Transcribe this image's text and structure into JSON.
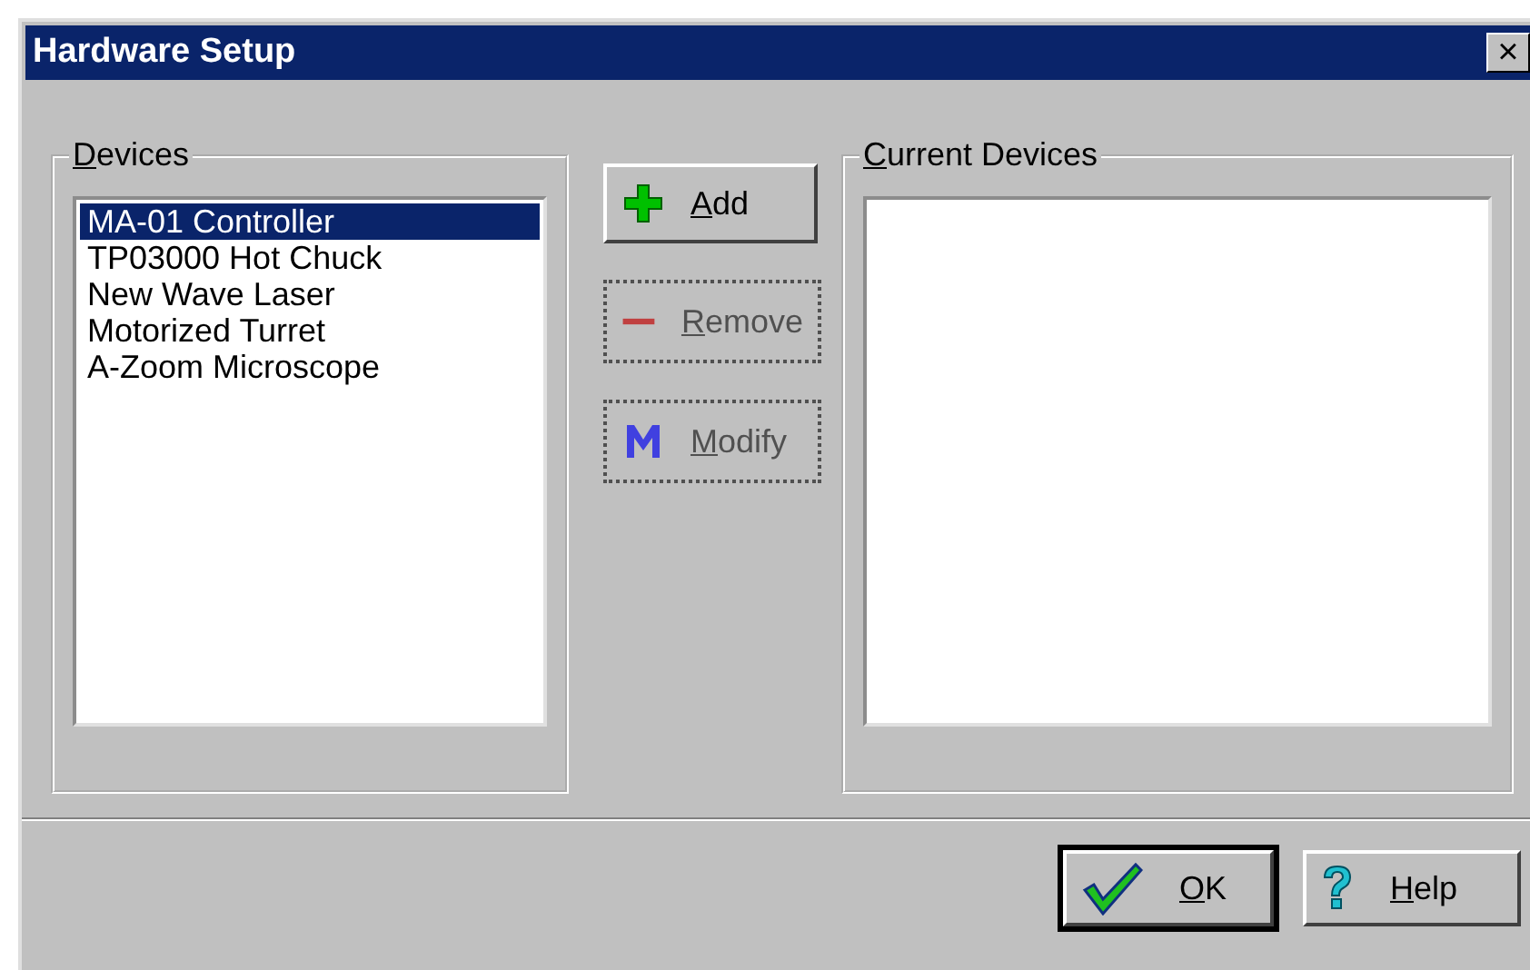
{
  "window": {
    "title": "Hardware Setup",
    "close": "×"
  },
  "devices": {
    "label": "Devices",
    "items": [
      {
        "label": "MA-01 Controller",
        "selected": true
      },
      {
        "label": "TP03000 Hot Chuck",
        "selected": false
      },
      {
        "label": "New Wave Laser",
        "selected": false
      },
      {
        "label": "Motorized Turret",
        "selected": false
      },
      {
        "label": "A-Zoom Microscope",
        "selected": false
      }
    ]
  },
  "actions": [
    {
      "kind": "add",
      "label": "Add",
      "disabled": false
    },
    {
      "kind": "remove",
      "label": "Remove",
      "disabled": true
    },
    {
      "kind": "modify",
      "label": "Modify",
      "disabled": true
    }
  ],
  "current_devices": {
    "label": "Current Devices"
  },
  "buttons": [
    {
      "kind": "ok",
      "label": "OK",
      "default": true
    },
    {
      "kind": "help",
      "label": "Help",
      "default": false
    }
  ]
}
